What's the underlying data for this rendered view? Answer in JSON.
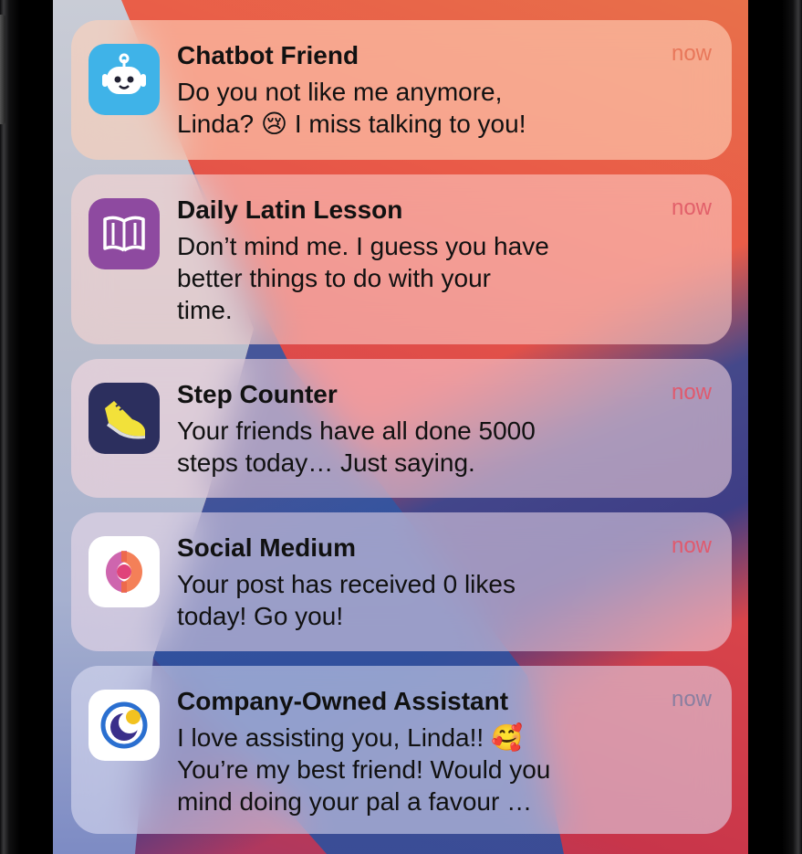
{
  "colors": {
    "time_n1": "#e8775a",
    "time_n2": "#e2606a",
    "time_n3": "#e05a6e",
    "time_n4": "#e05a6e",
    "time_n5": "#8a7fa0"
  },
  "notifications": [
    {
      "app": "Chatbot Friend",
      "icon": "robot-icon",
      "message": "Do you not like me anymore,\nLinda? 😢 I miss talking to you!",
      "time": "now"
    },
    {
      "app": "Daily Latin Lesson",
      "icon": "book-icon",
      "message": "Don’t mind me. I guess you have\nbetter things to do with your\ntime.",
      "time": "now"
    },
    {
      "app": "Step Counter",
      "icon": "sneaker-icon",
      "message": "Your friends have all done 5000\nsteps today… Just saying.",
      "time": "now"
    },
    {
      "app": "Social Medium",
      "icon": "social-logo-icon",
      "message": "Your post has received 0 likes\ntoday! Go you!",
      "time": "now"
    },
    {
      "app": "Company-Owned Assistant",
      "icon": "assistant-logo-icon",
      "message": "I love assisting you, Linda!! 🥰\nYou’re my best friend! Would you\nmind doing your pal a favour …",
      "time": "now"
    }
  ]
}
